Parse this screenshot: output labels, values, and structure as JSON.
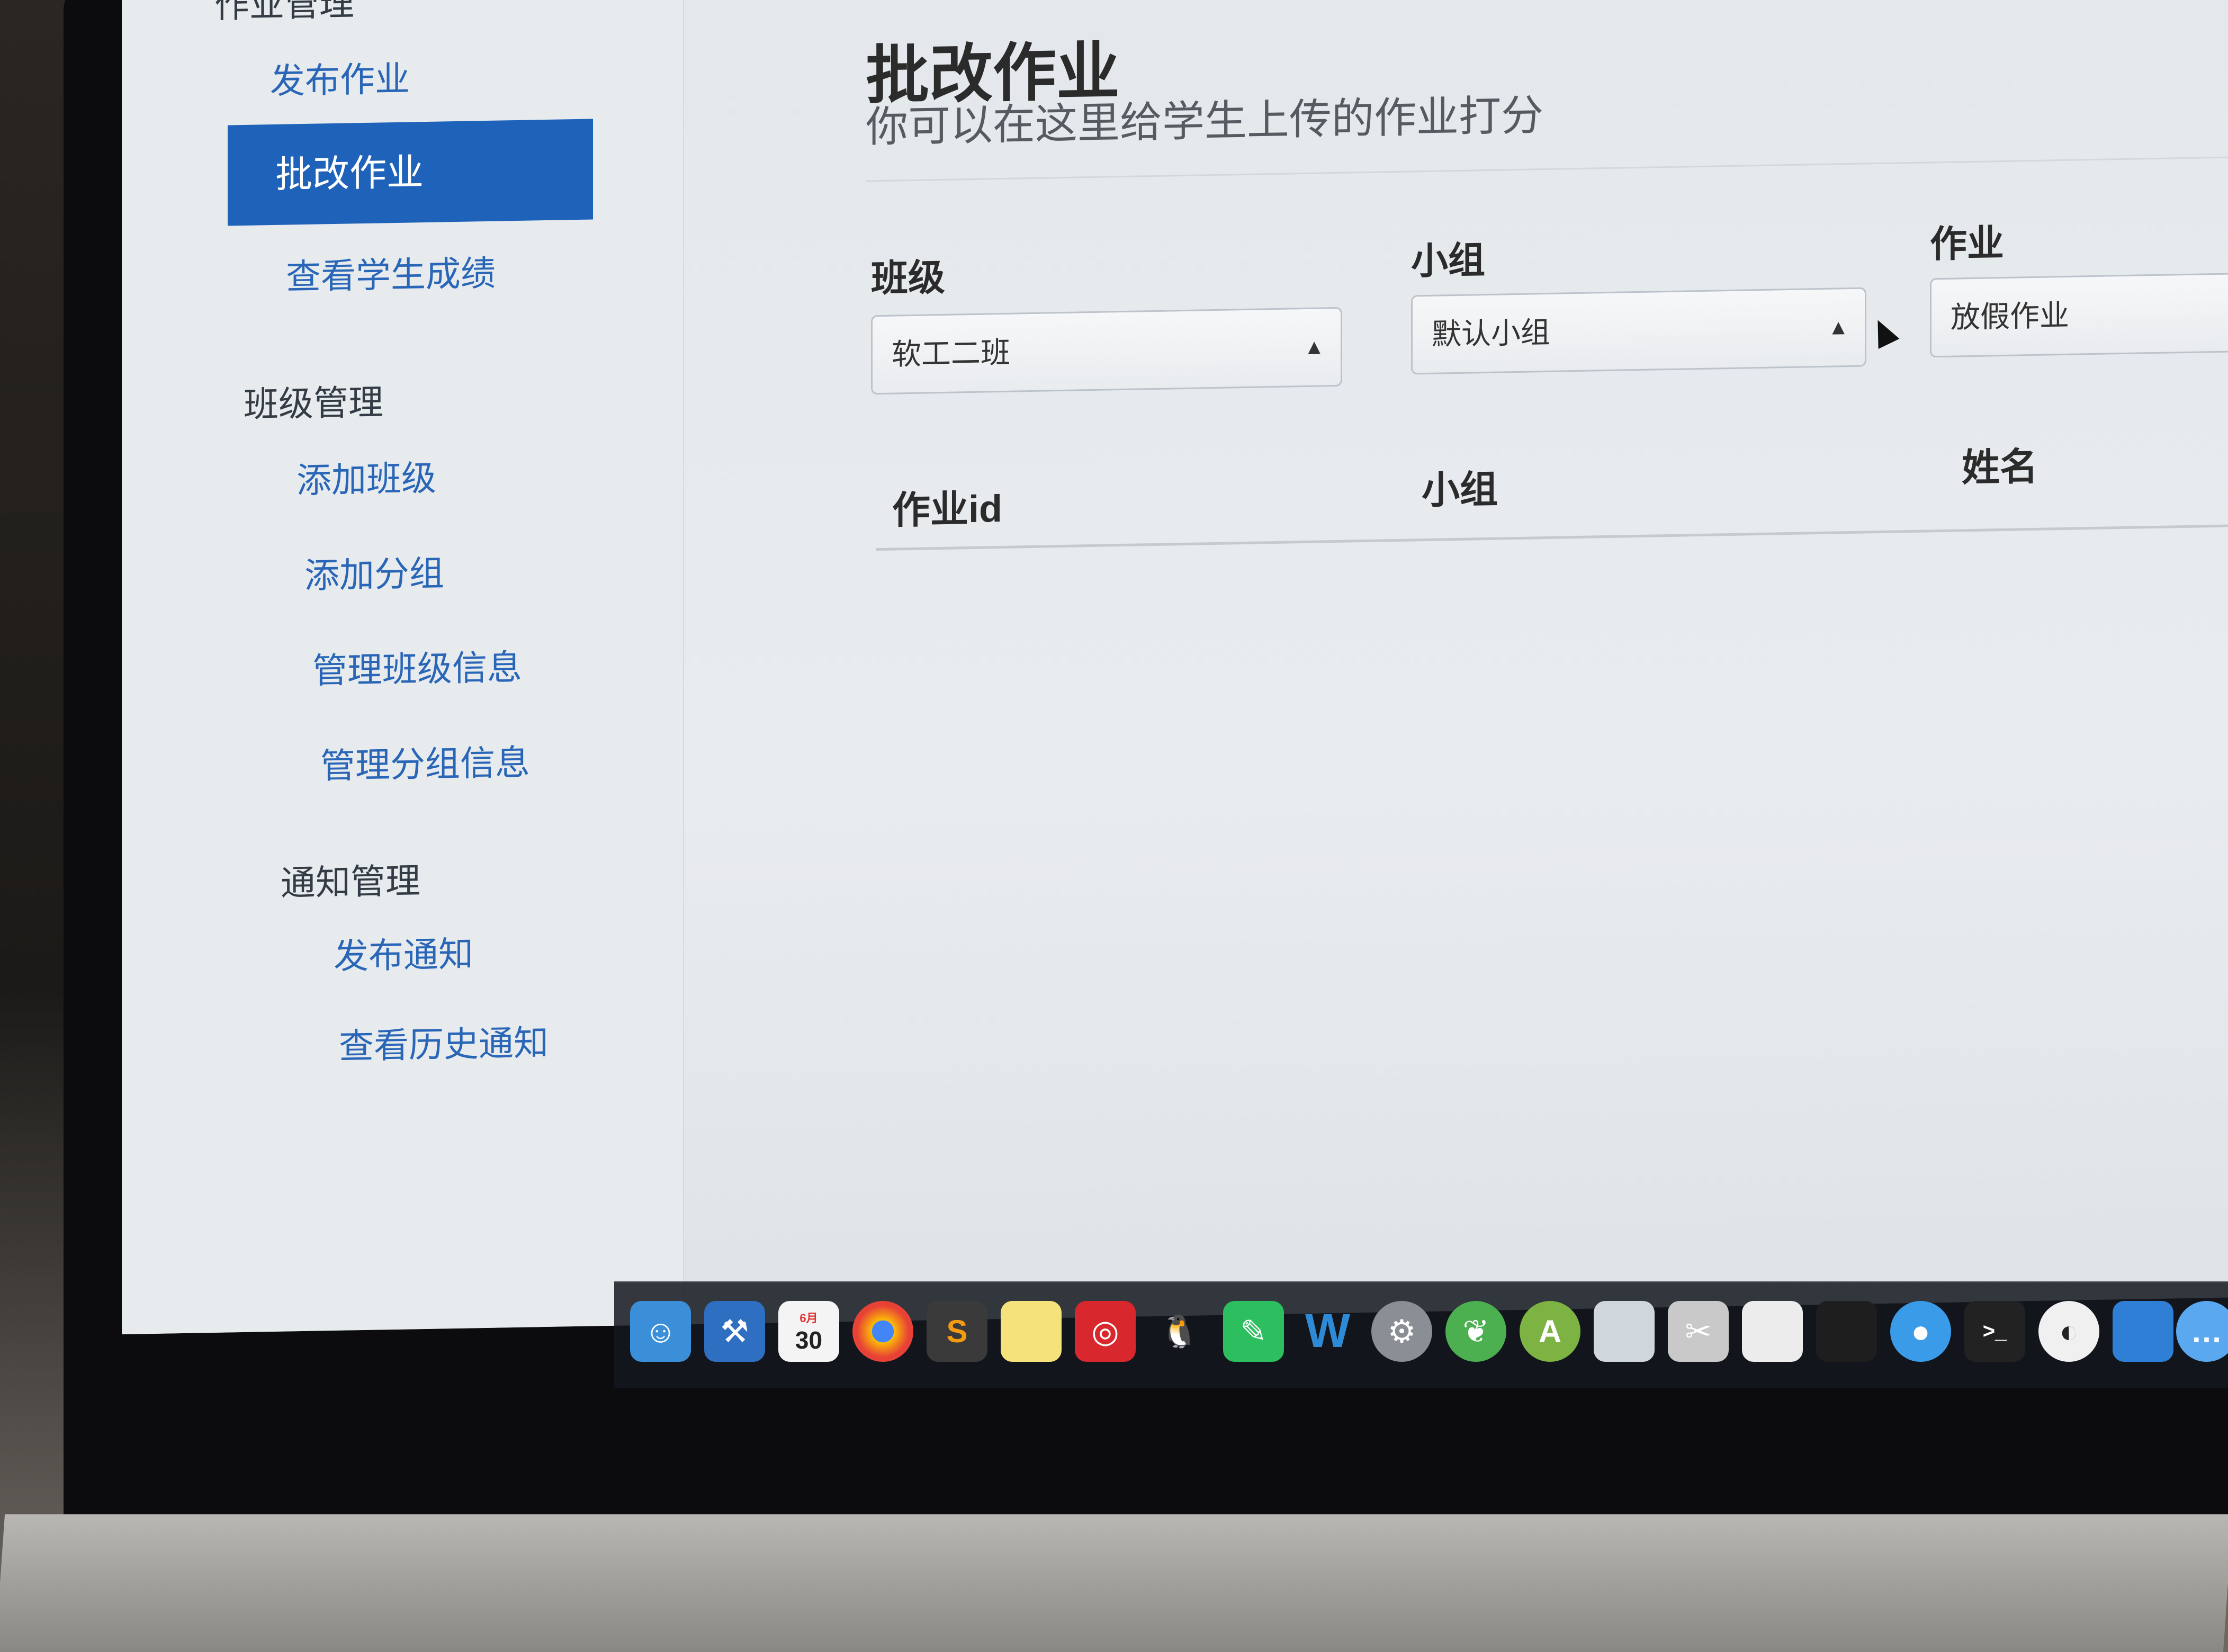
{
  "sidebar": {
    "section_homework_partial": "作业管理",
    "items": [
      {
        "label": "发布作业"
      },
      {
        "label": "批改作业",
        "active": true
      },
      {
        "label": "查看学生成绩"
      }
    ],
    "section_class": "班级管理",
    "class_items": [
      {
        "label": "添加班级"
      },
      {
        "label": "添加分组"
      },
      {
        "label": "管理班级信息"
      },
      {
        "label": "管理分组信息"
      }
    ],
    "section_notice": "通知管理",
    "notice_items": [
      {
        "label": "发布通知"
      },
      {
        "label": "查看历史通知"
      }
    ]
  },
  "main": {
    "title": "批改作业",
    "subtitle": "你可以在这里给学生上传的作业打分",
    "filters": {
      "class_label": "班级",
      "class_value": "软工二班",
      "group_label": "小组",
      "group_value": "默认小组",
      "homework_label": "作业",
      "homework_value": "放假作业"
    },
    "table": {
      "columns": [
        "作业id",
        "小组",
        "姓名"
      ]
    }
  },
  "dock": {
    "calendar_day": "30",
    "calendar_month": "6月",
    "icons": [
      "finder-icon",
      "xcode-icon",
      "calendar-icon",
      "chrome-icon",
      "sublime-icon",
      "notes-icon",
      "netease-music-icon",
      "qq-icon",
      "evernote-icon",
      "webstorm-icon",
      "system-preferences-icon",
      "spring-icon",
      "android-studio-icon",
      "preview-icon",
      "utilities-icon",
      "textedit-icon",
      "blank-icon",
      "qq-bubble-icon",
      "terminal-icon",
      "github-icon",
      "keynote-icon",
      "messages-icon"
    ],
    "colors": {
      "finder": "#3b8fd9",
      "xcode": "#2f6fc1",
      "calendar": "#f4f4f4",
      "chrome": "#e84236",
      "sublime": "#3a3a3a",
      "notes": "#f5e27a",
      "netease": "#d8282d",
      "qq": "#ffffff",
      "evernote": "#2dbe60",
      "webstorm": "#2f8ad6",
      "syspref": "#8a8f95",
      "spring": "#4caf50",
      "android": "#7cb342",
      "preview": "#cfd6dc",
      "utilities": "#c9c9c9",
      "textedit": "#ececec",
      "blank": "#1e1e1e",
      "qqbubble": "#3a9be8",
      "terminal": "#222222",
      "github": "#f0f0f0",
      "keynote": "#2f7fd6",
      "messages": "#5aa9f0"
    }
  },
  "accent_color": "#1e62b9"
}
